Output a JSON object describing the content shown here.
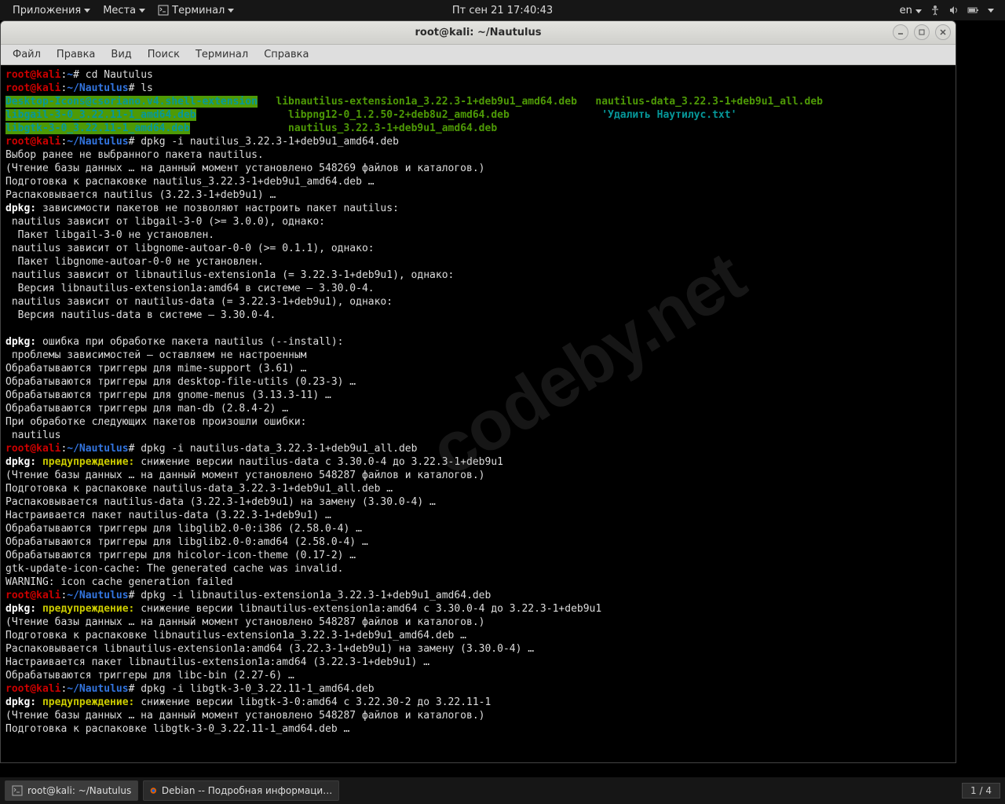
{
  "top_panel": {
    "apps": "Приложения",
    "places": "Места",
    "active_app": "Терминал",
    "clock": "Пт сен 21  17:40:43",
    "lang": "en"
  },
  "window": {
    "title": "root@kali: ~/Nautulus",
    "menus": [
      "Файл",
      "Правка",
      "Вид",
      "Поиск",
      "Терминал",
      "Справка"
    ]
  },
  "prompt": {
    "user": "root@kali",
    "home": "~",
    "dir": "~/Nautulus",
    "sep": ":",
    "sym": "#"
  },
  "cmds": {
    "cd": "cd Nautulus",
    "ls": "ls",
    "dpkg1": "dpkg -i nautilus_3.22.3-1+deb9u1_amd64.deb",
    "dpkg2": "dpkg -i nautilus-data_3.22.3-1+deb9u1_all.deb",
    "dpkg3": "dpkg -i libnautilus-extension1a_3.22.3-1+deb9u1_amd64.deb",
    "dpkg4": "dpkg -i libgtk-3-0_3.22.11-1_amd64.deb"
  },
  "ls": {
    "c1a": "Desktop-Icons@csoriano.v4.shell-extension",
    "c1b": "libgail-3-0_3.22.11-1_amd64.deb",
    "c1c": "libgtk-3-0_3.22.11-1_amd64.deb",
    "c2a": "libnautilus-extension1a_3.22.3-1+deb9u1_amd64.deb",
    "c2b": "libpng12-0_1.2.50-2+deb8u2_amd64.deb",
    "c2c": "nautilus_3.22.3-1+deb9u1_amd64.deb",
    "c3a": "nautilus-data_3.22.3-1+deb9u1_all.deb",
    "c3b": "'Удалить Наутилус.txt'"
  },
  "out": {
    "l1": "Выбор ранее не выбранного пакета nautilus.",
    "l2": "(Чтение базы данных … на данный момент установлено 548269 файлов и каталогов.)",
    "l3": "Подготовка к распаковке nautilus_3.22.3-1+deb9u1_amd64.deb …",
    "l4": "Распаковывается nautilus (3.22.3-1+deb9u1) …",
    "dpkg_dep": "dpkg:",
    "dep_head": " зависимости пакетов не позволяют настроить пакет nautilus:",
    "d1": " nautilus зависит от libgail-3-0 (>= 3.0.0), однако:",
    "d1b": "  Пакет libgail-3-0 не установлен.",
    "d2": " nautilus зависит от libgnome-autoar-0-0 (>= 0.1.1), однако:",
    "d2b": "  Пакет libgnome-autoar-0-0 не установлен.",
    "d3": " nautilus зависит от libnautilus-extension1a (= 3.22.3-1+deb9u1), однако:",
    "d3b": "  Версия libnautilus-extension1a:amd64 в системе — 3.30.0-4.",
    "d4": " nautilus зависит от nautilus-data (= 3.22.3-1+deb9u1), однако:",
    "d4b": "  Версия nautilus-data в системе — 3.30.0-4.",
    "err_head": " ошибка при обработке пакета nautilus (--install):",
    "err1": " проблемы зависимостей — оставляем не настроенным",
    "trig1": "Обрабатываются триггеры для mime-support (3.61) …",
    "trig2": "Обрабатываются триггеры для desktop-file-utils (0.23-3) …",
    "trig3": "Обрабатываются триггеры для gnome-menus (3.13.3-11) …",
    "trig4": "Обрабатываются триггеры для man-db (2.8.4-2) …",
    "err2": "При обработке следующих пакетов произошли ошибки:",
    "err3": " nautilus",
    "warn_label": "предупреждение:",
    "w1": " снижение версии nautilus-data с 3.30.0-4 до 3.22.3-1+deb9u1",
    "l2b": "(Чтение базы данных … на данный момент установлено 548287 файлов и каталогов.)",
    "p2": "Подготовка к распаковке nautilus-data_3.22.3-1+deb9u1_all.deb …",
    "r2": "Распаковывается nautilus-data (3.22.3-1+deb9u1) на замену (3.30.0-4) …",
    "n2": "Настраивается пакет nautilus-data (3.22.3-1+deb9u1) …",
    "t5": "Обрабатываются триггеры для libglib2.0-0:i386 (2.58.0-4) …",
    "t6": "Обрабатываются триггеры для libglib2.0-0:amd64 (2.58.0-4) …",
    "t7": "Обрабатываются триггеры для hicolor-icon-theme (0.17-2) …",
    "gtk1": "gtk-update-icon-cache: The generated cache was invalid.",
    "gtk2": "WARNING: icon cache generation failed",
    "w2": " снижение версии libnautilus-extension1a:amd64 с 3.30.0-4 до 3.22.3-1+deb9u1",
    "p3": "Подготовка к распаковке libnautilus-extension1a_3.22.3-1+deb9u1_amd64.deb …",
    "r3": "Распаковывается libnautilus-extension1a:amd64 (3.22.3-1+deb9u1) на замену (3.30.0-4) …",
    "n3": "Настраивается пакет libnautilus-extension1a:amd64 (3.22.3-1+deb9u1) …",
    "t8": "Обрабатываются триггеры для libc-bin (2.27-6) …",
    "w3": " снижение версии libgtk-3-0:amd64 с 3.22.30-2 до 3.22.11-1",
    "p4": "Подготовка к распаковке libgtk-3-0_3.22.11-1_amd64.deb …"
  },
  "watermark": "codeby.net",
  "taskbar": {
    "task1": "root@kali: ~/Nautulus",
    "task2": "Debian -- Подробная информаци…",
    "ws": "1 / 4"
  }
}
